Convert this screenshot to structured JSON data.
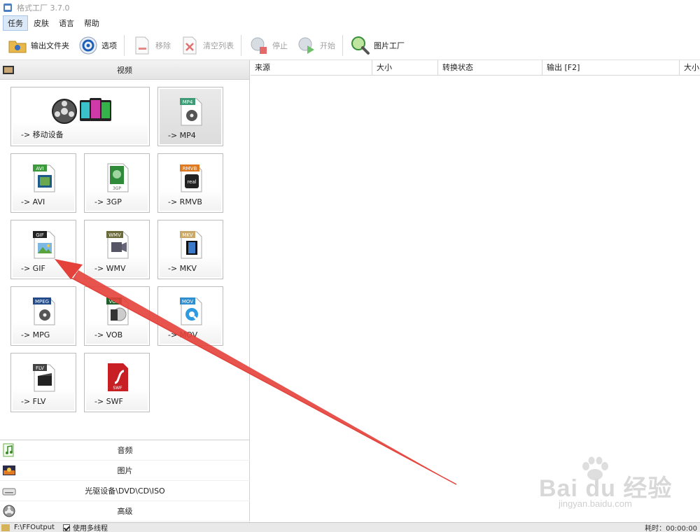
{
  "window": {
    "title": "格式工厂 3.7.0"
  },
  "menu": [
    {
      "label": "任务",
      "active": true
    },
    {
      "label": "皮肤"
    },
    {
      "label": "语言"
    },
    {
      "label": "帮助"
    }
  ],
  "toolbar": {
    "output_folder": "输出文件夹",
    "options": "选项",
    "remove": "移除",
    "clear_list": "清空列表",
    "stop": "停止",
    "start": "开始",
    "picture_factory": "图片工厂"
  },
  "video_category": {
    "label": "视频"
  },
  "tiles": [
    {
      "label": "-> 移动设备",
      "badge": ""
    },
    {
      "label": "-> MP4",
      "badge": "MP4"
    },
    {
      "label": "-> AVI",
      "badge": "AVI"
    },
    {
      "label": "-> 3GP",
      "badge": ""
    },
    {
      "label": "-> RMVB",
      "badge": "RMVB"
    },
    {
      "label": "-> GIF",
      "badge": "GIF"
    },
    {
      "label": "-> WMV",
      "badge": "WMV"
    },
    {
      "label": "-> MKV",
      "badge": "MKV"
    },
    {
      "label": "-> MPG",
      "badge": "MPEG"
    },
    {
      "label": "-> VOB",
      "badge": "VOB"
    },
    {
      "label": "-> MOV",
      "badge": "MOV"
    },
    {
      "label": "-> FLV",
      "badge": "FLV"
    },
    {
      "label": "-> SWF",
      "badge": ""
    }
  ],
  "icon_text": {
    "3gp": "3GP",
    "real": "real",
    "swf": "SWF"
  },
  "other_categories": [
    {
      "label": "音频"
    },
    {
      "label": "图片"
    },
    {
      "label": "光驱设备\\DVD\\CD\\ISO"
    },
    {
      "label": "高级"
    }
  ],
  "columns": [
    "来源",
    "大小",
    "转换状态",
    "输出 [F2]",
    "大小"
  ],
  "status": {
    "output_path": "F:\\FFOutput",
    "multithread_label": "使用多线程",
    "elapsed": "耗时：00:00:00"
  },
  "watermark": {
    "brand": "Bai du 经验",
    "url": "jingyan.baidu.com"
  },
  "colors": {
    "arrow": "#e3413a",
    "selected_tile": "#dcdcdc"
  }
}
